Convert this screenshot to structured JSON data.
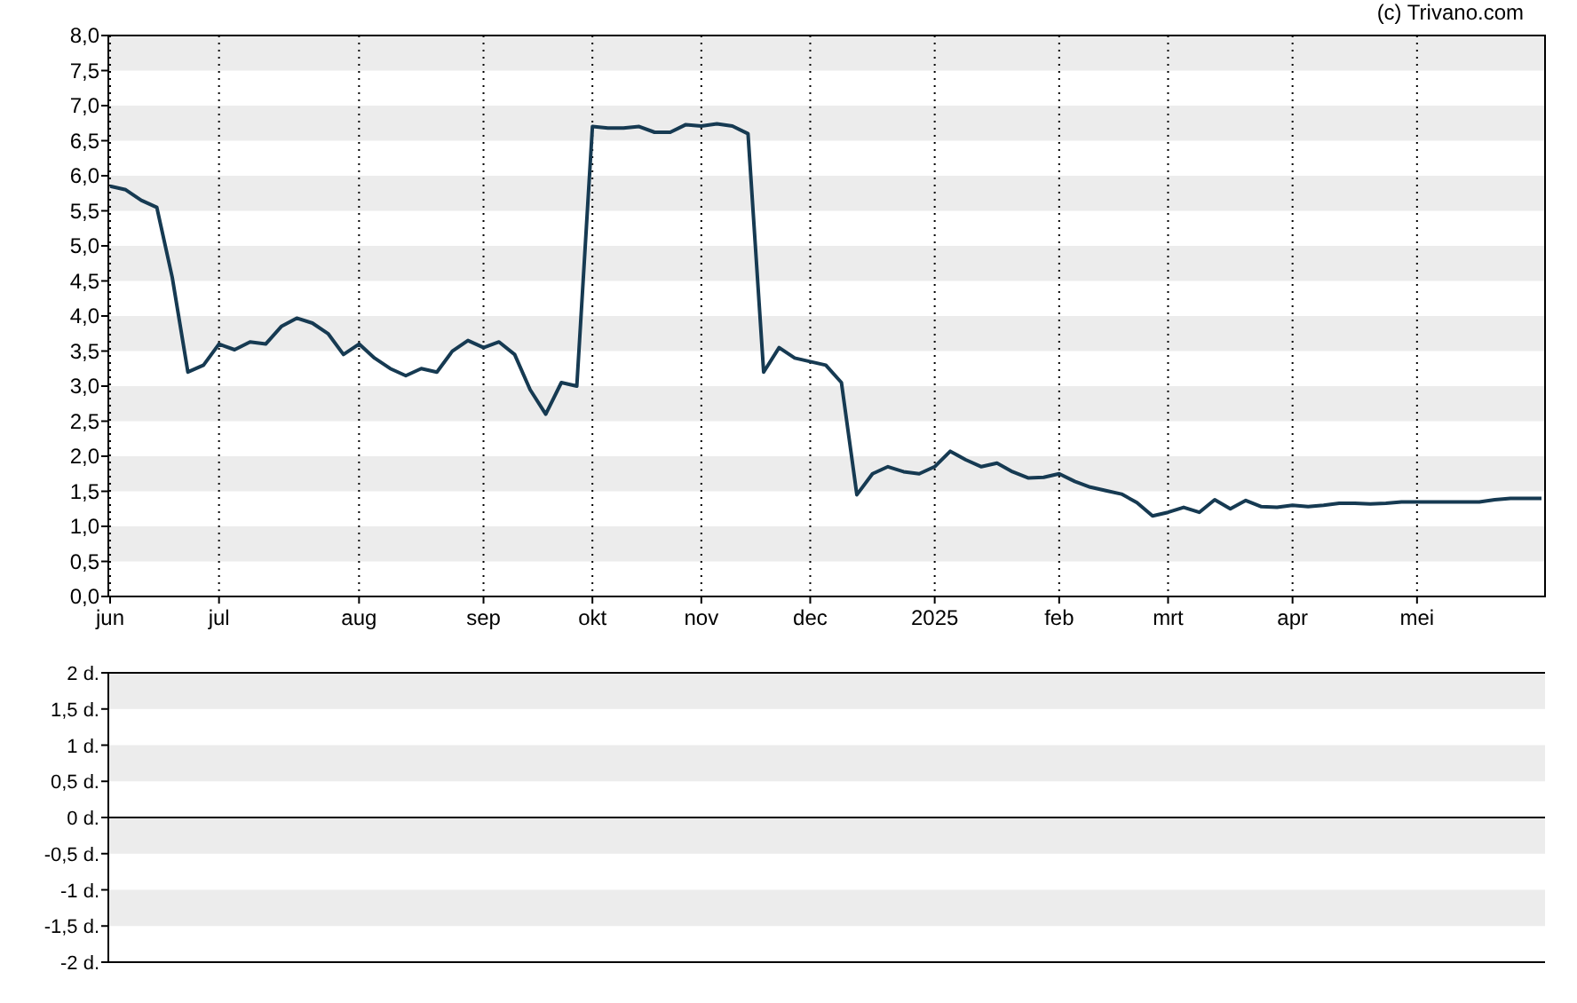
{
  "copyright": "(c) Trivano.com",
  "price_chart": {
    "chart_data": {
      "type": "line",
      "grid": true,
      "ylim": [
        0,
        8
      ],
      "categories": [
        "jun",
        null,
        null,
        null,
        null,
        null,
        null,
        "jul",
        null,
        null,
        null,
        null,
        null,
        null,
        null,
        null,
        "aug",
        null,
        null,
        null,
        null,
        null,
        null,
        null,
        "sep",
        null,
        null,
        null,
        null,
        null,
        null,
        "okt",
        null,
        null,
        null,
        null,
        null,
        null,
        "nov",
        null,
        null,
        null,
        null,
        null,
        null,
        "dec",
        null,
        null,
        null,
        null,
        null,
        null,
        null,
        "2025",
        null,
        null,
        null,
        null,
        null,
        null,
        null,
        "feb",
        null,
        null,
        null,
        null,
        null,
        null,
        "mrt",
        null,
        null,
        null,
        null,
        null,
        null,
        null,
        "apr",
        null,
        null,
        null,
        null,
        null,
        null,
        null,
        "mei",
        null,
        null,
        null,
        null,
        null,
        null,
        null,
        null
      ],
      "yticks": [
        {
          "value": 0,
          "label": "0,0"
        },
        {
          "value": 0.5,
          "label": "0,5"
        },
        {
          "value": 1,
          "label": "1,0"
        },
        {
          "value": 1.5,
          "label": "1,5"
        },
        {
          "value": 2,
          "label": "2,0"
        },
        {
          "value": 2.5,
          "label": "2,5"
        },
        {
          "value": 3,
          "label": "3,0"
        },
        {
          "value": 3.5,
          "label": "3,5"
        },
        {
          "value": 4,
          "label": "4,0"
        },
        {
          "value": 4.5,
          "label": "4,5"
        },
        {
          "value": 5,
          "label": "5,0"
        },
        {
          "value": 5.5,
          "label": "5,5"
        },
        {
          "value": 6,
          "label": "6,0"
        },
        {
          "value": 6.5,
          "label": "6,5"
        },
        {
          "value": 7,
          "label": "7,0"
        },
        {
          "value": 7.5,
          "label": "7,5"
        },
        {
          "value": 8,
          "label": "8,0"
        }
      ],
      "series": [
        {
          "color": "#163a52",
          "values": [
            5.85,
            5.8,
            5.65,
            5.55,
            4.55,
            3.2,
            3.3,
            3.6,
            3.52,
            3.63,
            3.6,
            3.85,
            3.97,
            3.9,
            3.75,
            3.45,
            3.6,
            3.4,
            3.25,
            3.15,
            3.25,
            3.2,
            3.5,
            3.65,
            3.55,
            3.63,
            3.45,
            2.95,
            2.6,
            3.05,
            3.0,
            6.7,
            6.68,
            6.68,
            6.7,
            6.62,
            6.62,
            6.73,
            6.71,
            6.74,
            6.71,
            6.6,
            3.2,
            3.55,
            3.4,
            3.35,
            3.3,
            3.05,
            1.45,
            1.75,
            1.85,
            1.78,
            1.75,
            1.85,
            2.07,
            1.95,
            1.85,
            1.9,
            1.78,
            1.69,
            1.7,
            1.75,
            1.64,
            1.56,
            1.51,
            1.46,
            1.34,
            1.15,
            1.2,
            1.27,
            1.2,
            1.38,
            1.25,
            1.37,
            1.28,
            1.27,
            1.3,
            1.28,
            1.3,
            1.33,
            1.33,
            1.32,
            1.33,
            1.35,
            1.35,
            1.35,
            1.35,
            1.35,
            1.35,
            1.38,
            1.4,
            1.4,
            1.4
          ]
        }
      ]
    }
  },
  "lower_panel": {
    "y_labels": [
      "2 d.",
      "1,5 d.",
      "1 d.",
      "0,5 d.",
      "0 d.",
      "-0,5 d.",
      "-1 d.",
      "-1,5 d.",
      "-2 d."
    ]
  }
}
